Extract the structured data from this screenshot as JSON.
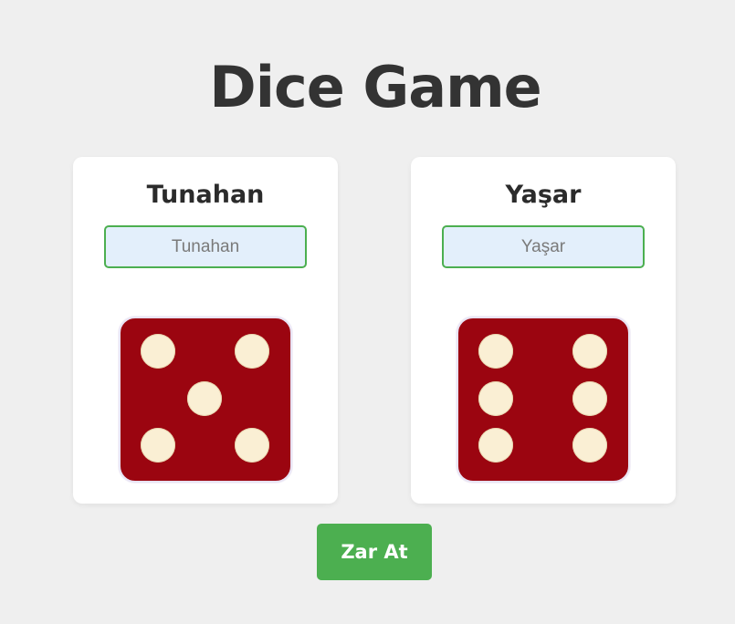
{
  "title": "Dice Game",
  "players": [
    {
      "name": "Tunahan",
      "input_placeholder": "Tunahan",
      "input_value": "",
      "die_value": 5
    },
    {
      "name": "Yaşar",
      "input_placeholder": "Yaşar",
      "input_value": "",
      "die_value": 6
    }
  ],
  "roll_button_label": "Zar At",
  "colors": {
    "background": "#efefef",
    "card": "#ffffff",
    "die": "#9b0510",
    "pip": "#faefd4",
    "accent": "#4caf50",
    "input_background": "#e3effb",
    "text": "#333333"
  }
}
